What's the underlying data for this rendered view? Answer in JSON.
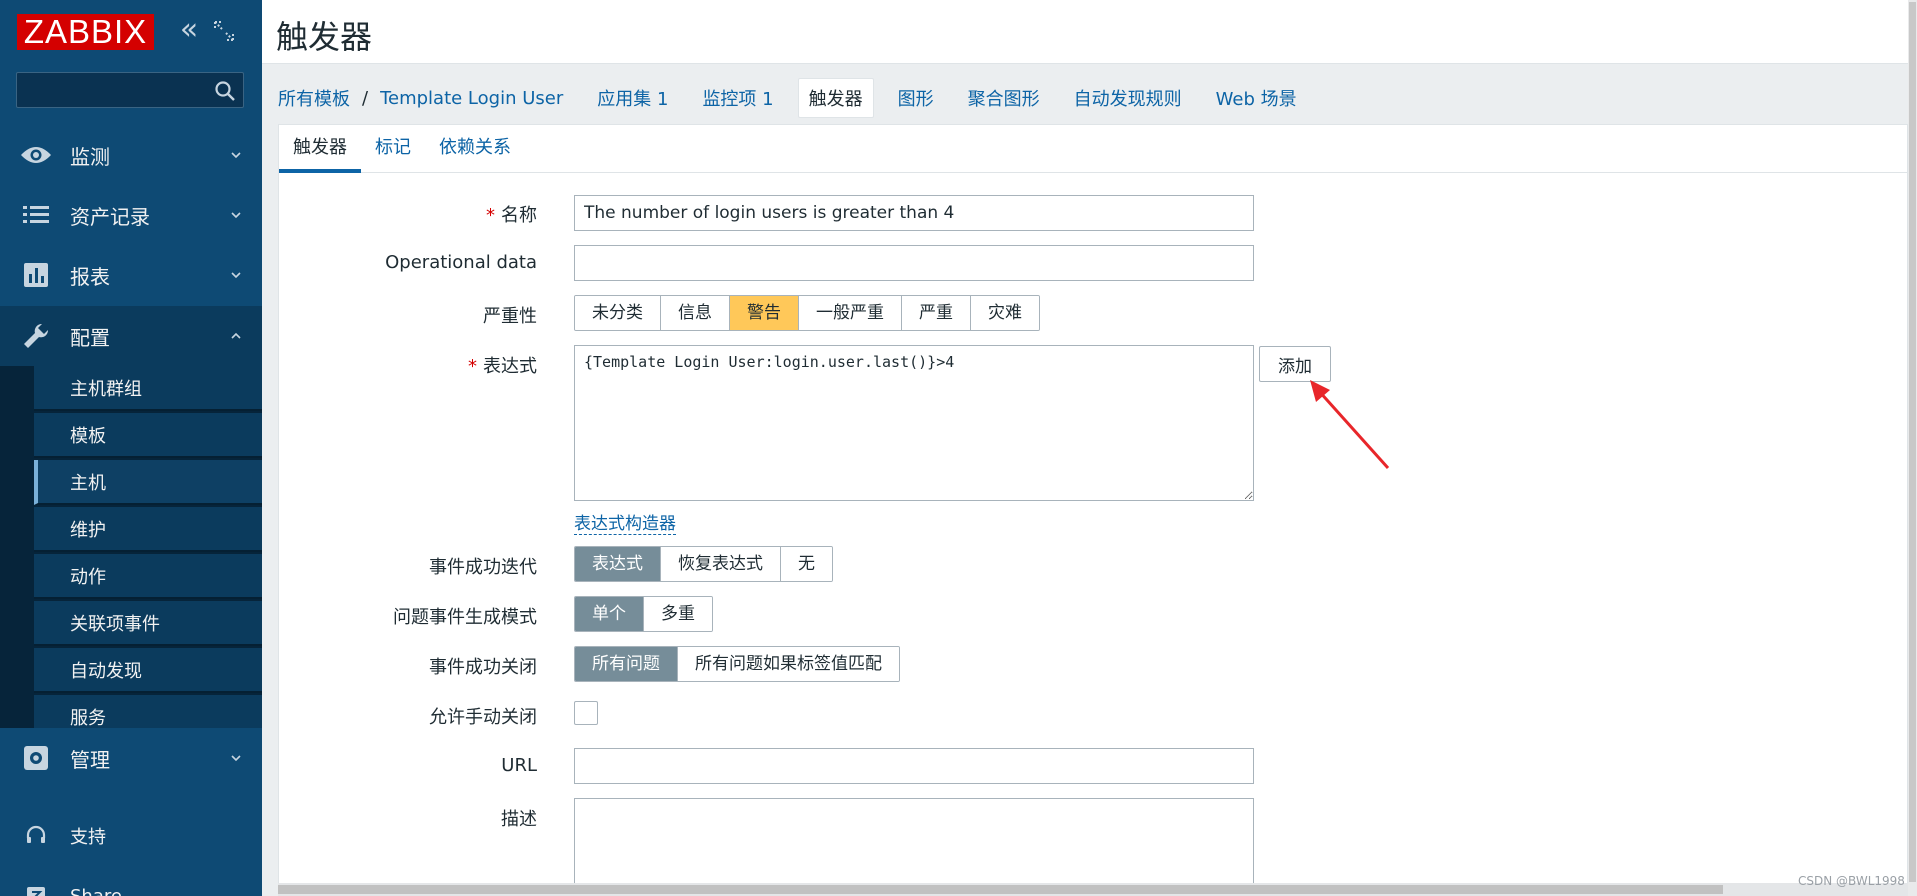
{
  "sidebar": {
    "logo": "ZABBIX",
    "search": {
      "value": "",
      "placeholder": ""
    },
    "menu": [
      {
        "label": "监测",
        "icon": "eye-icon"
      },
      {
        "label": "资产记录",
        "icon": "list-icon"
      },
      {
        "label": "报表",
        "icon": "chart-icon"
      },
      {
        "label": "配置",
        "icon": "wrench-icon"
      },
      {
        "label": "管理",
        "icon": "gear-icon"
      },
      {
        "label": "支持",
        "icon": "headset-icon"
      },
      {
        "label": "Share",
        "icon": "share-icon"
      }
    ],
    "submenu": [
      "主机群组",
      "模板",
      "主机",
      "维护",
      "动作",
      "关联项事件",
      "自动发现",
      "服务"
    ]
  },
  "header": {
    "title": "触发器"
  },
  "breadcrumb": {
    "all_templates": "所有模板",
    "template": "Template Login User",
    "tabs": [
      "应用集 1",
      "监控项 1",
      "触发器",
      "图形",
      "聚合图形",
      "自动发现规则",
      "Web 场景"
    ]
  },
  "form_tabs": [
    "触发器",
    "标记",
    "依赖关系"
  ],
  "form": {
    "name_label": "名称",
    "name_value": "The number of login users is greater than 4",
    "opdata_label": "Operational data",
    "opdata_value": "",
    "severity_label": "严重性",
    "severity_options": [
      "未分类",
      "信息",
      "警告",
      "一般严重",
      "严重",
      "灾难"
    ],
    "severity_selected": "警告",
    "expression_label": "表达式",
    "expression_value": "{Template Login User:login.user.last()}>4",
    "add_button": "添加",
    "builder_link": "表达式构造器",
    "ok_event_label": "事件成功迭代",
    "ok_event_options": [
      "表达式",
      "恢复表达式",
      "无"
    ],
    "problem_mode_label": "问题事件生成模式",
    "problem_mode_options": [
      "单个",
      "多重"
    ],
    "ok_close_label": "事件成功关闭",
    "ok_close_options": [
      "所有问题",
      "所有问题如果标签值匹配"
    ],
    "manual_close_label": "允许手动关闭",
    "url_label": "URL",
    "url_value": "",
    "desc_label": "描述"
  },
  "watermark": "CSDN @BWL1998",
  "colors": {
    "sidebar": "#0e4a74",
    "logo": "#d40000",
    "link": "#0d64a6",
    "warning": "#ffc859",
    "selected": "#768d99",
    "annotation_arrow": "#e8262a"
  }
}
